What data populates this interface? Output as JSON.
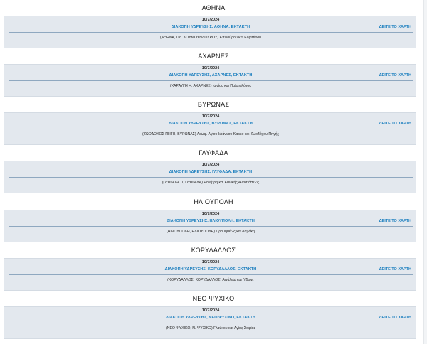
{
  "sections": [
    {
      "title": "ΑΘΗΝΑ",
      "date": "10/7/2024",
      "headline": "ΔΙΑΚΟΠΗ ΥΔΡΕΥΣΗΣ, ΑΘΗΝΑ, ΕΚΤΑΚΤΗ",
      "map_link": "ΔΕΙΤΕ ΤΟ ΧΑΡΤΗ",
      "detail": "(ΑΘΗΝΑ, ΠΛ. ΚΟΥΜΟΥΝΔΟΥΡΟΥ) Επικούρου και Ευριπίδου"
    },
    {
      "title": "ΑΧΑΡΝΕΣ",
      "date": "10/7/2024",
      "headline": "ΔΙΑΚΟΠΗ ΥΔΡΕΥΣΗΣ, ΑΧΑΡΝΕΣ, ΕΚΤΑΚΤΗ",
      "map_link": "ΔΕΙΤΕ ΤΟ ΧΑΡΤΗ",
      "detail": "(ΧΑΡΑΥΓΗ Η, ΑΧΑΡΝΕΣ) Ιωνίας και Παλαιολόγου"
    },
    {
      "title": "ΒΥΡΩΝΑΣ",
      "date": "10/7/2024",
      "headline": "ΔΙΑΚΟΠΗ ΥΔΡΕΥΣΗΣ, ΒΥΡΩΝΑΣ, ΕΚΤΑΚΤΗ",
      "map_link": "ΔΕΙΤΕ ΤΟ ΧΑΡΤΗ",
      "detail": "(ΖΩΟΔΟΧΟΣ ΠΗΓΗ, ΒΥΡΩΝΑΣ) Λεωφ. Αγίου Ιωάννου Καρέα και Ζωοδόχου Πηγής"
    },
    {
      "title": "ΓΛΥΦΑΔΑ",
      "date": "10/7/2024",
      "headline": "ΔΙΑΚΟΠΗ ΥΔΡΕΥΣΗΣ, ΓΛΥΦΑΔΑ, ΕΚΤΑΚΤΗ",
      "map_link": "",
      "detail": "(ΓΛΥΦΑΔΑ Π, ΓΛΥΦΑΔΑ) Ρονήτρη και Εθνικής Αντιστάσεως"
    },
    {
      "title": "ΗΛΙΟΥΠΟΛΗ",
      "date": "10/7/2024",
      "headline": "ΔΙΑΚΟΠΗ ΥΔΡΕΥΣΗΣ, ΗΛΙΟΥΠΟΛΗ, ΕΚΤΑΚΤΗ",
      "map_link": "ΔΕΙΤΕ ΤΟ ΧΑΡΤΗ",
      "detail": "(ΗΛΙΟΥΠΟΛΗ, ΗΛΙΟΥΠΟΛΗ) Προμηθέως και Δαβάκη"
    },
    {
      "title": "ΚΟΡΥΔΑΛΛΟΣ",
      "date": "10/7/2024",
      "headline": "ΔΙΑΚΟΠΗ ΥΔΡΕΥΣΗΣ, ΚΟΡΥΔΑΛΛΟΣ, ΕΚΤΑΚΤΗ",
      "map_link": "ΔΕΙΤΕ ΤΟ ΧΑΡΤΗ",
      "detail": "(ΚΟΡΥΔΑΛΛΟΣ, ΚΟΡΥΔΑΛΛΟΣ) Αιγάλεω και Ύδρας"
    },
    {
      "title": "ΝΕΟ ΨΥΧΙΚΟ",
      "date": "10/7/2024",
      "headline": "ΔΙΑΚΟΠΗ ΥΔΡΕΥΣΗΣ, ΝΕΟ ΨΥΧΙΚΟ, ΕΚΤΑΚΤΗ",
      "map_link": "ΔΕΙΤΕ ΤΟ ΧΑΡΤΗ",
      "detail": "(ΝΕΟ ΨΥΧΙΚΟ, Ν. ΨΥΧΙΚΟ) Γλαύκου και Αγίας Σοφίας"
    }
  ],
  "colors": {
    "link": "#1c7fbf",
    "card_background": "#e3e8ee",
    "divider": "#8fa8c0"
  }
}
